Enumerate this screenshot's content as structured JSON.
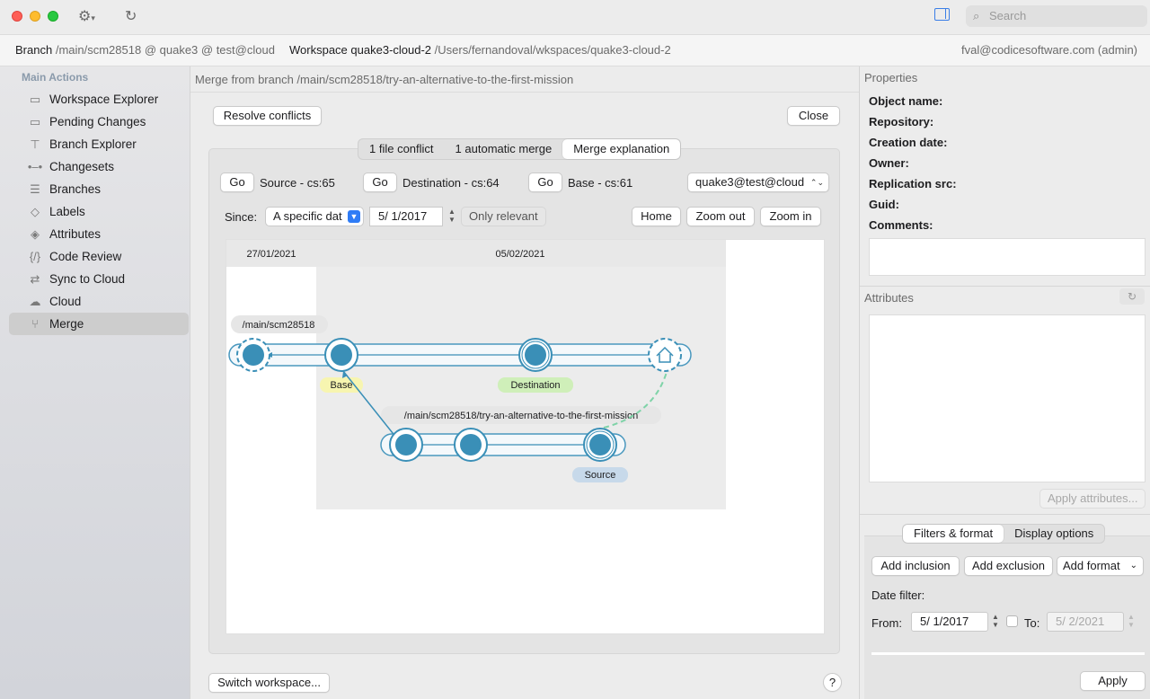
{
  "titlebar": {
    "search_placeholder": "Search"
  },
  "infobar": {
    "branch_label": "Branch",
    "branch_value": "/main/scm28518 @ quake3 @ test@cloud",
    "workspace_label": "Workspace",
    "workspace_name": "quake3-cloud-2",
    "workspace_path": "/Users/fernandoval/wkspaces/quake3-cloud-2",
    "user": "fval@codicesoftware.com (admin)"
  },
  "sidebar": {
    "header": "Main Actions",
    "items": [
      {
        "label": "Workspace Explorer",
        "icon": "folder-icon"
      },
      {
        "label": "Pending Changes",
        "icon": "pending-changes-icon"
      },
      {
        "label": "Branch Explorer",
        "icon": "branch-explorer-icon"
      },
      {
        "label": "Changesets",
        "icon": "changesets-icon"
      },
      {
        "label": "Branches",
        "icon": "branches-icon"
      },
      {
        "label": "Labels",
        "icon": "label-icon"
      },
      {
        "label": "Attributes",
        "icon": "attributes-icon"
      },
      {
        "label": "Code Review",
        "icon": "code-review-icon"
      },
      {
        "label": "Sync to Cloud",
        "icon": "sync-icon"
      },
      {
        "label": "Cloud",
        "icon": "cloud-icon"
      },
      {
        "label": "Merge",
        "icon": "merge-icon",
        "active": true
      }
    ]
  },
  "main": {
    "title": "Merge from branch /main/scm28518/try-an-alternative-to-the-first-mission",
    "resolve_button": "Resolve conflicts",
    "close_button": "Close",
    "tabs": [
      "1 file conflict",
      "1 automatic merge",
      "Merge explanation"
    ],
    "selected_tab": "Merge explanation",
    "go_label": "Go",
    "source_label": "Source - cs:65",
    "destination_label": "Destination - cs:64",
    "base_label": "Base - cs:61",
    "repo_select": "quake3@test@cloud",
    "since_label": "Since:",
    "since_select": "A specific dat",
    "since_date": "5/  1/2017",
    "only_relevant": "Only relevant",
    "home_button": "Home",
    "zoom_out_button": "Zoom out",
    "zoom_in_button": "Zoom in",
    "switch_workspace_button": "Switch workspace...",
    "help_button": "?",
    "graph": {
      "dates": [
        "27/01/2021",
        "05/02/2021"
      ],
      "branch_main": "/main/scm28518",
      "branch_child": "/main/scm28518/try-an-alternative-to-the-first-mission",
      "tag_base": "Base",
      "tag_destination": "Destination",
      "tag_source": "Source",
      "color_base_tag": "#f7f5b0",
      "color_destination_tag": "#cfefb9",
      "color_source_tag": "#c7d9ea",
      "color_node": "#3a8fb7"
    }
  },
  "properties": {
    "header": "Properties",
    "fields": [
      "Object name:",
      "Repository:",
      "Creation date:",
      "Owner:",
      "Replication src:",
      "Guid:",
      "Comments:"
    ],
    "attributes_header": "Attributes",
    "apply_attributes": "Apply attributes...",
    "tabs": [
      "Filters & format",
      "Display options"
    ],
    "selected_tab": "Filters & format",
    "add_inclusion": "Add inclusion",
    "add_exclusion": "Add exclusion",
    "add_format": "Add format",
    "date_filter_label": "Date filter:",
    "from_label": "From:",
    "from_date": "5/  1/2017",
    "to_label": "To:",
    "to_date": "5/  2/2021",
    "apply_button": "Apply"
  }
}
